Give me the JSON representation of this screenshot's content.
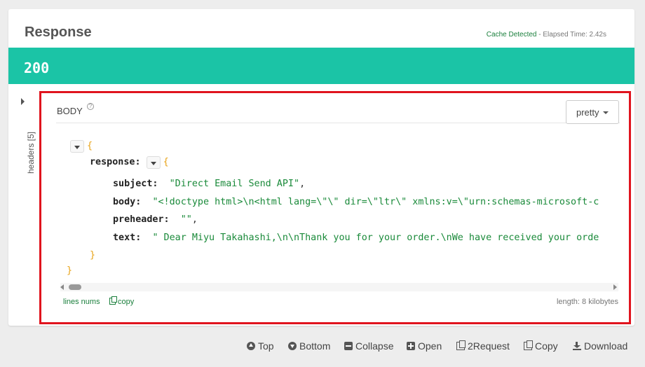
{
  "response": {
    "title": "Response",
    "cache_status": "Cache Detected",
    "separator": " - ",
    "elapsed": "Elapsed Time: 2.42s",
    "status_code": "200"
  },
  "headers_panel": {
    "label": "headers [5]"
  },
  "body": {
    "label": "BODY",
    "help_icon": "?",
    "format": "pretty",
    "lines": {
      "l1": "{",
      "l2_key": "response:",
      "l2_brace": "{",
      "l3_key": "subject:",
      "l3_val": "\"Direct Email Send API\"",
      "l3_comma": ",",
      "l4_key": "body:",
      "l4_val": "\"<!doctype html>\\n<html lang=\\\"\\\" dir=\\\"ltr\\\" xmlns:v=\\\"urn:schemas-microsoft-c",
      "l5_key": "preheader:",
      "l5_val": "\"\"",
      "l5_comma": ",",
      "l6_key": "text:",
      "l6_val": "\" Dear Miyu Takahashi,\\n\\nThank you for your order.\\nWe have received your orde",
      "l7": "}",
      "l8": "}"
    },
    "lines_nums_label": "lines nums",
    "copy_label": "copy",
    "length": "length: 8 kilobytes"
  },
  "toolbar": {
    "top": "Top",
    "bottom": "Bottom",
    "collapse": "Collapse",
    "open": "Open",
    "to_request": "2Request",
    "copy": "Copy",
    "download": "Download"
  },
  "colors": {
    "status_bar": "#1bc4a6",
    "highlight": "#e0141e",
    "string": "#1a8a3a",
    "brace": "#e8a317",
    "link": "#1a7f3c"
  }
}
